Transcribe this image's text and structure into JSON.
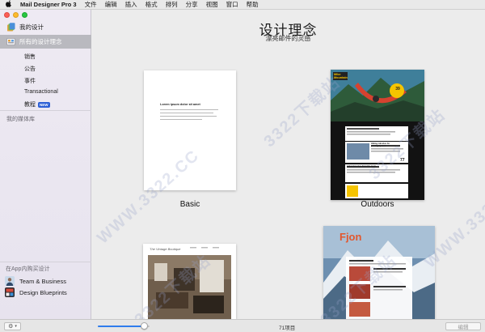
{
  "menubar": {
    "app_name": "Mail Designer Pro 3",
    "items": [
      "文件",
      "编辑",
      "插入",
      "格式",
      "排列",
      "分享",
      "视图",
      "窗口",
      "帮助"
    ]
  },
  "sidebar": {
    "my_designs": "我的设计",
    "all_ideas": "所有的设计理念",
    "categories": [
      "销售",
      "公告",
      "事件",
      "Transactional",
      "教程"
    ],
    "new_badge": "NEW",
    "media_library": "我的媒体库",
    "iap_title": "在App内购买设计",
    "iap_items": [
      "Team & Business",
      "Design Blueprints"
    ]
  },
  "main": {
    "title": "设计理念",
    "subtitle": "漂亮邮件的灵感",
    "templates": [
      {
        "label": "Basic"
      },
      {
        "label": "Outdoors"
      }
    ],
    "basic_preview": {
      "heading": "Lorem ipsum dolor sit amet"
    },
    "outdoors_preview": {
      "logo": "Mike Mountain",
      "price_1": "39",
      "price_2": "77",
      "heading_1": "Hiking calculus for photographers",
      "heading_2": "Adventure tips from the team"
    },
    "bottom_previews": [
      {
        "brand": "The Vintage Boutique"
      },
      {
        "brand": "Fjon"
      }
    ]
  },
  "footer": {
    "gear": "⚙",
    "count": "71项目",
    "edit": "编辑",
    "zoom": 0.9
  },
  "watermark": "3322下载站 WWW.3322.CC",
  "colors": {
    "accent": "#2f7ded",
    "selection": "#b9b9bf",
    "outdoors_yellow": "#f5c400"
  }
}
